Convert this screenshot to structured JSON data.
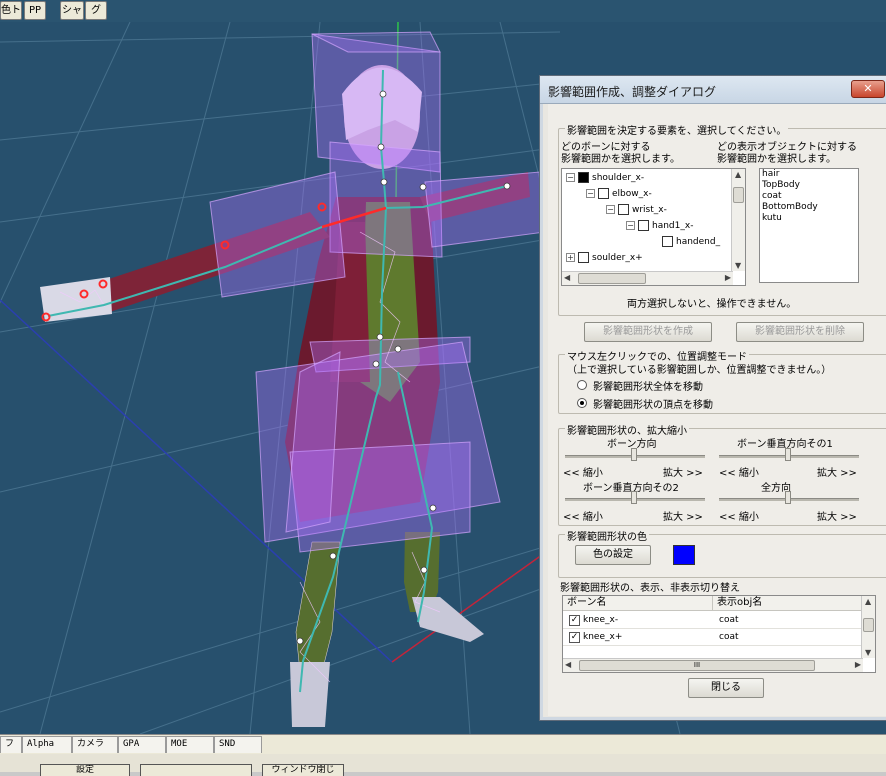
{
  "top_toolbar": {
    "buttons": [
      "色ト",
      "PP",
      "シャ",
      "グ"
    ]
  },
  "bottom_tabs": [
    "フ",
    "Alpha",
    "カメラ",
    "GPA",
    "MOE",
    "SND"
  ],
  "bottom_strip": {
    "buttons": [
      "設定",
      "",
      "ウィンドウ閉じ"
    ]
  },
  "dialog": {
    "title": "影響範囲作成、調整ダイアログ",
    "close_label": "✕",
    "select_group": {
      "label": "影響範囲を決定する要素を、選択してください。",
      "bone_caption_1": "どのボーンに対する",
      "bone_caption_2": "影響範囲かを選択します。",
      "obj_caption_1": "どの表示オブジェクトに対する",
      "obj_caption_2": "影響範囲かを選択します。",
      "bone_tree": [
        {
          "label": "shoulder_x-",
          "indent": 0,
          "filled": true
        },
        {
          "label": "elbow_x-",
          "indent": 1,
          "filled": false
        },
        {
          "label": "wrist_x-",
          "indent": 2,
          "filled": false
        },
        {
          "label": "hand1_x-",
          "indent": 3,
          "filled": false
        },
        {
          "label": "handend_",
          "indent": 4,
          "filled": false
        },
        {
          "label": "soulder_x+",
          "indent": 0,
          "filled": false
        }
      ],
      "objects": [
        "hair",
        "TopBody",
        "coat",
        "BottomBody",
        "kutu"
      ],
      "note": "両方選択しないと、操作できません。"
    },
    "create_button": "影響範囲形状を作成",
    "delete_button": "影響範囲形状を削除",
    "mouse_group": {
      "label": "マウス左クリックでの、位置調整モード",
      "note": "（上で選択している影響範囲しか、位置調整できません。）",
      "option_whole": "影響範囲形状全体を移動",
      "option_vertex": "影響範囲形状の頂点を移動",
      "selected": "vertex"
    },
    "scale_group": {
      "label": "影響範囲形状の、拡大縮小",
      "sliders": [
        {
          "title": "ボーン方向",
          "left": "<< 縮小",
          "right": "拡大 >>",
          "value": 0.5
        },
        {
          "title": "ボーン垂直方向その1",
          "left": "<< 縮小",
          "right": "拡大 >>",
          "value": 0.5
        },
        {
          "title": "ボーン垂直方向その2",
          "left": "<< 縮小",
          "right": "拡大 >>",
          "value": 0.5
        },
        {
          "title": "全方向",
          "left": "<< 縮小",
          "right": "拡大 >>",
          "value": 0.5
        }
      ]
    },
    "color_group": {
      "label": "影響範囲形状の色",
      "button": "色の設定",
      "color": "#0000ff"
    },
    "visibility": {
      "label": "影響範囲形状の、表示、非表示切り替え",
      "headers": [
        "ボーン名",
        "表示obj名"
      ],
      "rows": [
        {
          "bone": "knee_x-",
          "obj": "coat",
          "checked": true
        },
        {
          "bone": "knee_x+",
          "obj": "coat",
          "checked": true
        }
      ],
      "scroll_label": "III"
    },
    "close_button": "閉じる"
  }
}
